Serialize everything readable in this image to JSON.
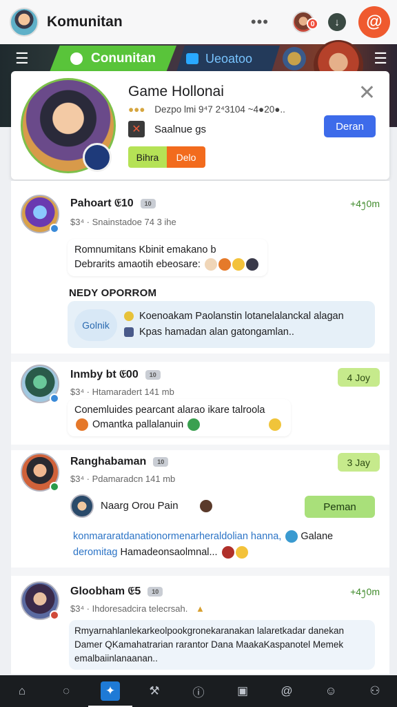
{
  "appbar": {
    "title": "Komunitan",
    "more_glyph": "•••",
    "notification_count": "0",
    "download_glyph": "↓",
    "profile_glyph": "@"
  },
  "banner": {
    "tab_active": "Conunitan",
    "tab_inactive": "Ueoatoo"
  },
  "profile": {
    "name": "Game Hollonai",
    "meta_dots": "●●●",
    "meta": "Dezpo lmi 9⁴7 2⁴3104 ~4●20●..",
    "row_text": "Saalnue gs",
    "btn_left": "Bihra",
    "btn_right": "Delo",
    "action_label": "Deran",
    "close_glyph": "✕"
  },
  "posts": [
    {
      "name": "Pahoart 𝔈10",
      "tag": "10",
      "sub": "$3⁴ · Snainstadoe 74 3 ihe",
      "time": "+4᪂0m",
      "bubble_line1": "Romnumitans Kbinit emakano b",
      "bubble_line2": "Debrarits amaotih ebeosare:",
      "section_title": "NEDY OPORROM",
      "link_pill": "Golnik",
      "link_line1": "Koenoakam Paolanstin lotanelalanckal alagan",
      "link_line2": "Kpas hamadan alan gatongamlan.."
    },
    {
      "name": "Inmby bt 𝔈00",
      "tag": "10",
      "sub": "$3⁴ · Htamaradert 141 mb",
      "time": "4 Joy",
      "bubble_line1": "Conemluides pearcant alarao ikare talroola",
      "bubble_line2": "Omantka pallalanuin"
    },
    {
      "name": "Ranghabaman",
      "tag": "10",
      "sub": "$3⁴ · Pdamaradcn 141 mb",
      "time": "3 Jay",
      "inline_title": "Naarg Orou Pain",
      "green_button": "Peman",
      "text_line1_a": "konmararatdanationormenarheraldolian hanna,",
      "text_line1_b": "Galane",
      "text_line2_a": "deromitag",
      "text_line2_b": "Hamadeonsaolmnal..."
    },
    {
      "name": "Gloobham 𝔈5",
      "tag": "10",
      "sub": "$3⁴ · Ihdoresadcira telecrsah.",
      "time": "+4᪂0m",
      "text_line1": "Rmyarnahlanlekarkeolpookgronekaranakan lalaretkadar danekan",
      "text_line2": "Damer QKamahatrarian rarantor Dana MaakaKaspanotel Memek",
      "text_line3": "emalbaiinlanaanan.."
    }
  ],
  "bottom_nav": [
    {
      "icon": "home-icon",
      "glyph": "⌂"
    },
    {
      "icon": "chat-icon",
      "glyph": "◌"
    },
    {
      "icon": "community-icon",
      "glyph": "✦"
    },
    {
      "icon": "tools-icon",
      "glyph": "⚒"
    },
    {
      "icon": "info-icon",
      "glyph": "ⓘ"
    },
    {
      "icon": "calendar-icon",
      "glyph": "▣"
    },
    {
      "icon": "at-icon",
      "glyph": "@"
    },
    {
      "icon": "emoji-icon",
      "glyph": "☺"
    },
    {
      "icon": "profile-icon",
      "glyph": "⚇"
    }
  ],
  "colors": {
    "accent_blue": "#3d6bea",
    "accent_green": "#59c43a",
    "accent_orange": "#f26b1d",
    "notification_red": "#f04c3a"
  }
}
